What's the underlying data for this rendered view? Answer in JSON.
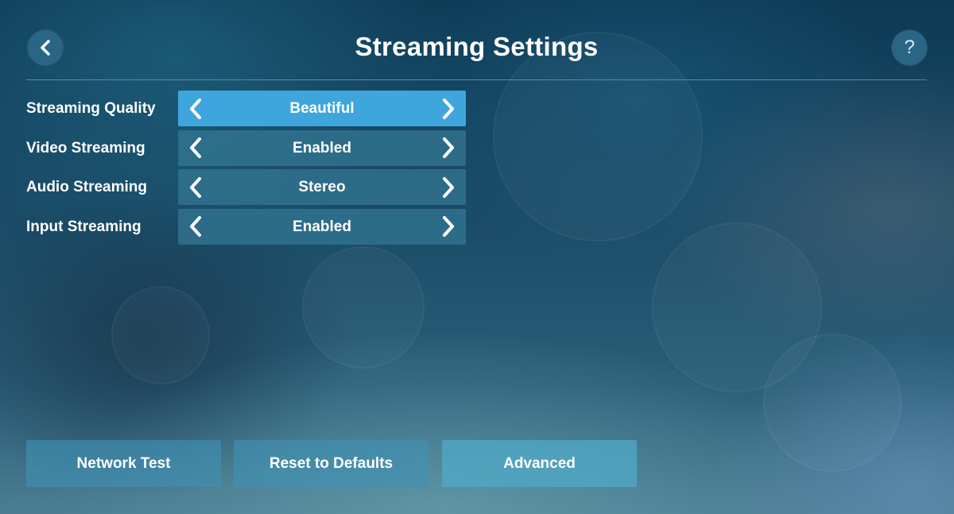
{
  "header": {
    "title": "Streaming Settings",
    "back_icon": "chevron-left-icon",
    "help_label": "?"
  },
  "settings": [
    {
      "label": "Streaming Quality",
      "value": "Beautiful",
      "active": true
    },
    {
      "label": "Video Streaming",
      "value": "Enabled",
      "active": false
    },
    {
      "label": "Audio Streaming",
      "value": "Stereo",
      "active": false
    },
    {
      "label": "Input Streaming",
      "value": "Enabled",
      "active": false
    }
  ],
  "buttons": {
    "network_test": "Network Test",
    "reset_defaults": "Reset to Defaults",
    "advanced": "Advanced"
  },
  "colors": {
    "active_selector": "#3ea6dc",
    "selector": "#347896",
    "button": "#4091b4"
  }
}
